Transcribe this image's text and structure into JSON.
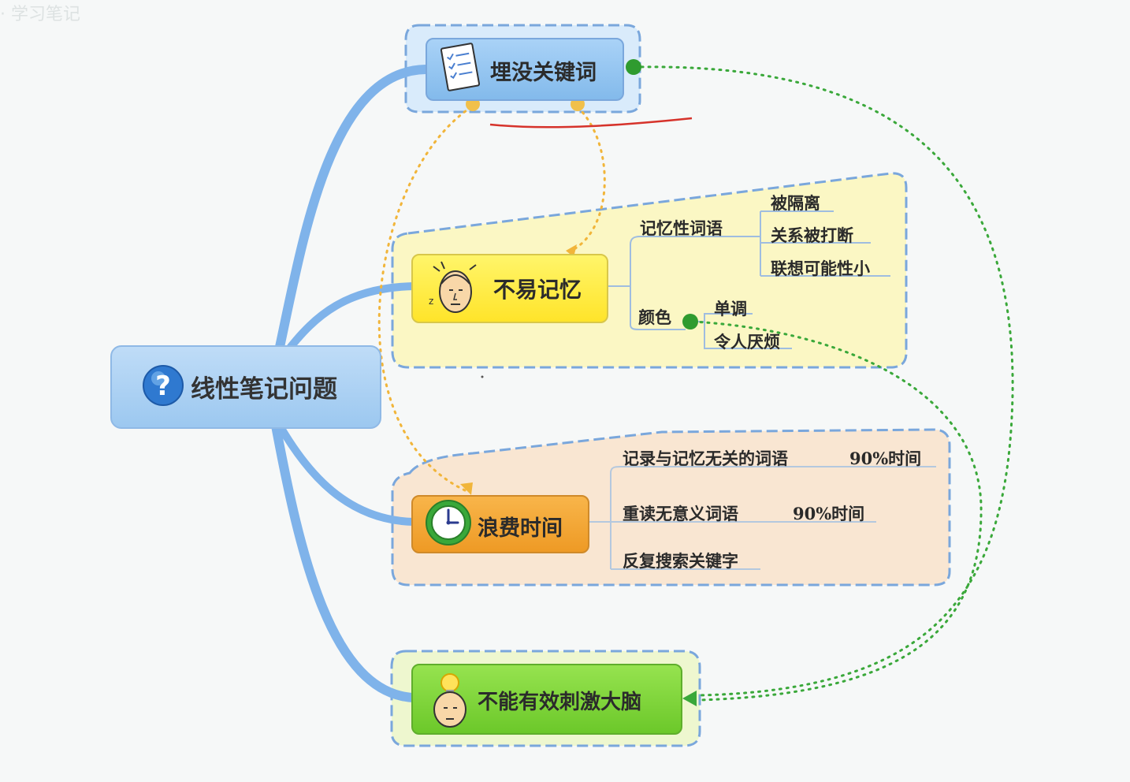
{
  "watermark": "· 学习笔记",
  "root": {
    "label": "线性笔记问题",
    "icon": "question-icon"
  },
  "branches": [
    {
      "id": "bury",
      "label": "埋没关键词",
      "icon": "checklist-icon",
      "color": "#8fc3ef"
    },
    {
      "id": "memory",
      "label": "不易记忆",
      "icon": "head-icon",
      "color": "#fff04a",
      "children": [
        {
          "label": "记忆性词语",
          "children": [
            "被隔离",
            "关系被打断",
            "联想可能性小"
          ]
        },
        {
          "label": "颜色",
          "children": [
            "单调",
            "令人厌烦"
          ]
        }
      ]
    },
    {
      "id": "waste",
      "label": "浪费时间",
      "icon": "clock-icon",
      "color": "#f3a43a",
      "children": [
        {
          "label": "记录与记忆无关的词语",
          "note": "90%时间"
        },
        {
          "label": "重读无意义词语",
          "note": "90%时间"
        },
        {
          "label": "反复搜索关键字",
          "note": ""
        }
      ]
    },
    {
      "id": "brain",
      "label": "不能有效刺激大脑",
      "icon": "lightbulb-head-icon",
      "color": "#7ed63a"
    }
  ],
  "colors": {
    "trunk": "#7fb3ea",
    "link_orange": "#f1b53a",
    "link_green": "#3aa83a",
    "memory_bg": "#fbf7c4",
    "waste_bg": "#f9e6d2",
    "brain_bg": "#eef7cf",
    "bury_bg": "#d9ebfb",
    "dashed_border": "#7aa7dc",
    "annotation_red": "#d6332b"
  }
}
